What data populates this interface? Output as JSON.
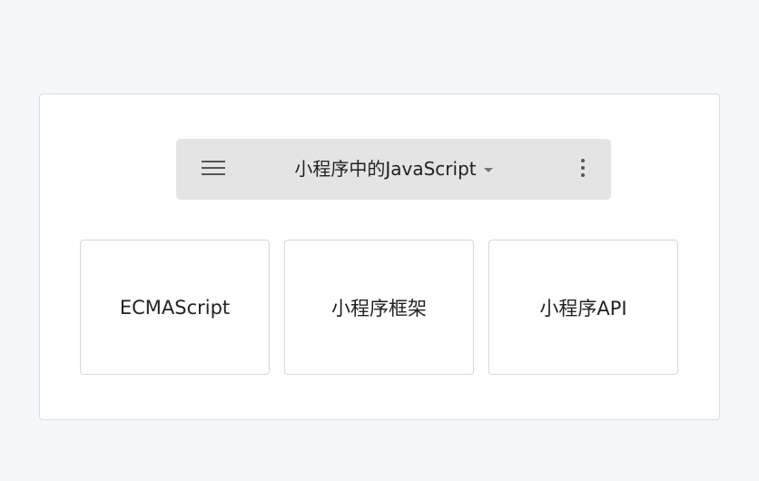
{
  "toolbar": {
    "title": "小程序中的JavaScript",
    "menu_icon": "hamburger-icon",
    "more_icon": "vertical-dots-icon"
  },
  "items": [
    {
      "label": "ECMAScript"
    },
    {
      "label": "小程序框架"
    },
    {
      "label": "小程序API"
    }
  ]
}
